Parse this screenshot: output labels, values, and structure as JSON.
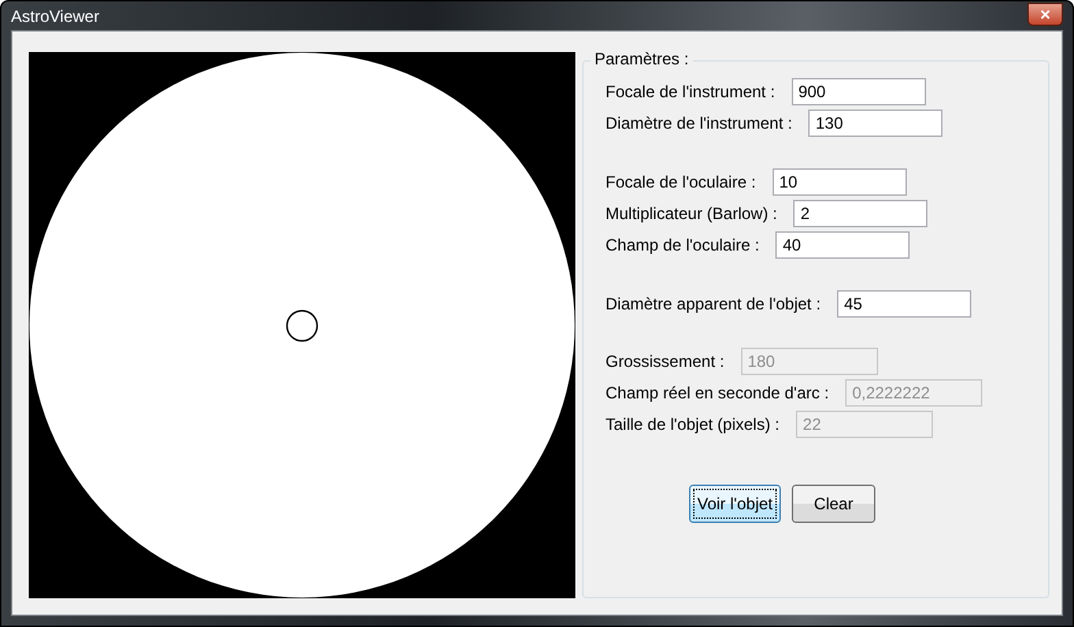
{
  "window": {
    "title": "AstroViewer",
    "close_button": "×"
  },
  "view": {
    "kind": "telescope-view"
  },
  "parameters": {
    "title": "Paramètres :",
    "sections": [
      {
        "fields": [
          {
            "label": "Focale de l'instrument :",
            "value": "900",
            "disabled": false
          },
          {
            "label": "Diamètre de l'instrument :",
            "value": "130",
            "disabled": false
          }
        ]
      },
      {
        "fields": [
          {
            "label": "Focale de l'oculaire :",
            "value": "10",
            "disabled": false
          },
          {
            "label": "Multiplicateur (Barlow) :",
            "value": "2",
            "disabled": false
          },
          {
            "label": "Champ de l'oculaire :",
            "value": "40",
            "disabled": false
          }
        ]
      },
      {
        "fields": [
          {
            "label": "Diamètre apparent de l'objet :",
            "value": "45",
            "disabled": false
          }
        ]
      },
      {
        "fields": [
          {
            "label": "Grossissement :",
            "value": "180",
            "disabled": true
          },
          {
            "label": "Champ réel en seconde d'arc :",
            "value": "0,2222222",
            "disabled": true
          },
          {
            "label": "Taille de l'objet (pixels) :",
            "value": "22",
            "disabled": true
          }
        ]
      }
    ],
    "buttons": [
      {
        "label": "Voir l'objet",
        "focused": true
      },
      {
        "label": "Clear",
        "focused": false
      }
    ]
  }
}
